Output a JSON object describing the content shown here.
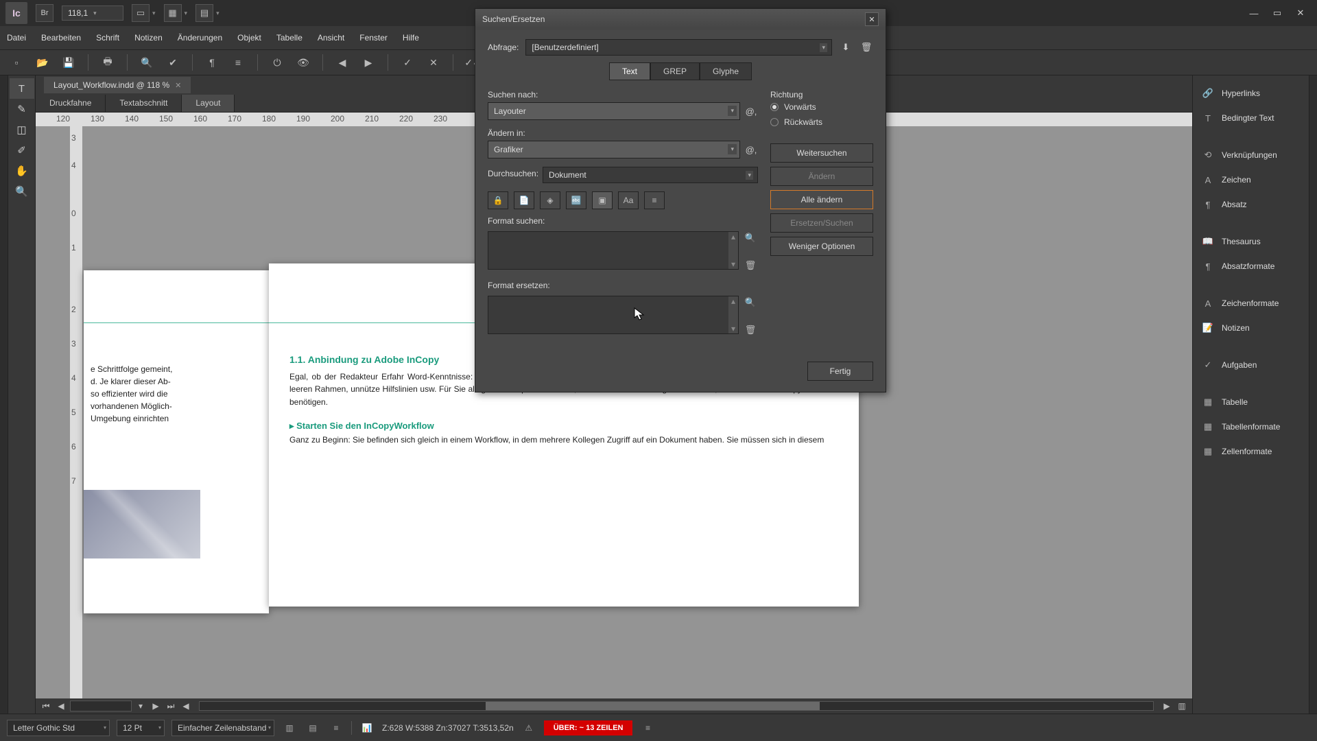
{
  "app": {
    "logo": "Ic",
    "bridge": "Br",
    "zoom": "118,1"
  },
  "win_controls": {
    "min": "—",
    "max": "▭",
    "close": "✕"
  },
  "menu": [
    "Datei",
    "Bearbeiten",
    "Schrift",
    "Notizen",
    "Änderungen",
    "Objekt",
    "Tabelle",
    "Ansicht",
    "Fenster",
    "Hilfe"
  ],
  "doc_tab": {
    "title": "Layout_Workflow.indd @ 118 %"
  },
  "view_tabs": {
    "a": "Druckfahne",
    "b": "Textabschnitt",
    "c": "Layout"
  },
  "ruler_h": [
    "120",
    "130",
    "140",
    "150",
    "160",
    "170",
    "180",
    "190",
    "200",
    "210",
    "220",
    "230"
  ],
  "ruler_v": [
    "3",
    "4",
    "0",
    "1",
    "2",
    "3",
    "4",
    "5",
    "6",
    "7"
  ],
  "page_left_text": "e Schrittfolge gemeint,\nd. Je klarer dieser Ab-\nso effizienter wird die\nvorhandenen Möglich-\nUmgebung einrichten",
  "page_right": {
    "h1": "1.1.  Anbindung zu Adobe InCopy",
    "p1": "Egal, ob der Redakteur Erfahr\nWord-Kenntnisse: Der Einstieg i\nsich Redakteur und Grafiker aber\nund die Dateiverwaltung der Programme.\nohne leeren Rahmen, unnütze Hilfslinien usw. Für Sie als  gibt es ein paar bekannte, aber auch neue InDesign-Funktionen, die Sie für den InCopy-Workflow benötigen.",
    "h2": "Starten Sie den InCopyWorkflow",
    "p2": "Ganz zu Beginn: Sie befinden sich gleich in einem Workflow, in dem mehrere Kollegen Zugriff auf ein Dokument haben. Sie müssen sich in diesem"
  },
  "dialog": {
    "title": "Suchen/Ersetzen",
    "query_lbl": "Abfrage:",
    "query_val": "[Benutzerdefiniert]",
    "tab_text": "Text",
    "tab_grep": "GREP",
    "tab_glyph": "Glyphe",
    "find_lbl": "Suchen nach:",
    "find_val": "Layouter",
    "change_lbl": "Ändern in:",
    "change_val": "Grafiker",
    "search_lbl": "Durchsuchen:",
    "search_val": "Dokument",
    "fmt_find_lbl": "Format suchen:",
    "fmt_change_lbl": "Format ersetzen:",
    "direction_lbl": "Richtung",
    "fwd": "Vorwärts",
    "bwd": "Rückwärts",
    "btn_find_next": "Weitersuchen",
    "btn_change": "Ändern",
    "btn_change_all": "Alle ändern",
    "btn_change_find": "Ersetzen/Suchen",
    "btn_fewer": "Weniger Optionen",
    "btn_done": "Fertig"
  },
  "right_panels": [
    {
      "icon": "🔗",
      "label": "Hyperlinks"
    },
    {
      "icon": "T",
      "label": "Bedingter Text"
    },
    {
      "icon": "⟲",
      "label": "Verknüpfungen"
    },
    {
      "icon": "A",
      "label": "Zeichen"
    },
    {
      "icon": "¶",
      "label": "Absatz"
    },
    {
      "icon": "📖",
      "label": "Thesaurus"
    },
    {
      "icon": "¶",
      "label": "Absatzformate"
    },
    {
      "icon": "A",
      "label": "Zeichenformate"
    },
    {
      "icon": "📝",
      "label": "Notizen"
    },
    {
      "icon": "✓",
      "label": "Aufgaben"
    },
    {
      "icon": "▦",
      "label": "Tabelle"
    },
    {
      "icon": "▦",
      "label": "Tabellenformate"
    },
    {
      "icon": "▦",
      "label": "Zellenformate"
    }
  ],
  "status": {
    "font": "Letter Gothic Std",
    "size": "12 Pt",
    "leading": "Einfacher Zeilenabstand",
    "metrics": "Z:628    W:5388    Zn:37027   T:3513,52n",
    "overset": "ÜBER:  ~ 13 ZEILEN"
  }
}
